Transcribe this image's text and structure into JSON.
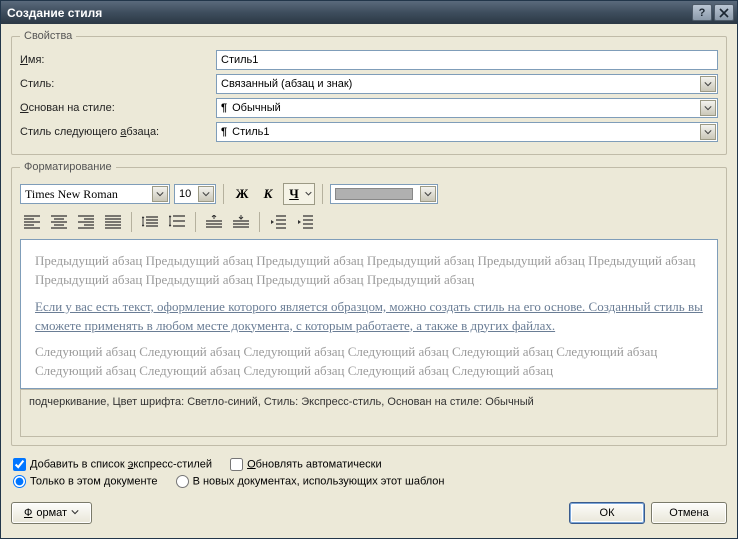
{
  "window": {
    "title": "Создание стиля",
    "help_aria": "Справка",
    "close_aria": "Закрыть"
  },
  "properties": {
    "legend": "Свойства",
    "name_label_pre": "",
    "name_label_ul": "И",
    "name_label_post": "мя:",
    "name_value": "Стиль1",
    "type_label": "Стиль:",
    "type_value": "Связанный (абзац и знак)",
    "based_label_pre": "",
    "based_label_ul": "О",
    "based_label_post": "снован на стиле:",
    "based_value": "Обычный",
    "next_label": "Стиль следующего ",
    "next_label_ul": "а",
    "next_label_post": "бзаца:",
    "next_value": "Стиль1"
  },
  "formatting": {
    "legend": "Форматирование",
    "font": "Times New Roman",
    "size": "10",
    "bold": "Ж",
    "italic": "К",
    "underline": "Ч"
  },
  "preview": {
    "prev_para": "Предыдущий абзац Предыдущий абзац Предыдущий абзац Предыдущий абзац Предыдущий абзац Предыдущий абзац Предыдущий абзац Предыдущий абзац Предыдущий абзац Предыдущий абзац",
    "sample": "Если у вас есть текст, оформление которого является образцом, можно создать стиль на его основе. Созданный стиль вы сможете применять в любом месте документа, с которым работаете, а также в других файлах.",
    "next_para": "Следующий абзац Следующий абзац Следующий абзац Следующий абзац Следующий абзац Следующий абзац Следующий абзац Следующий абзац Следующий абзац Следующий абзац Следующий абзац"
  },
  "description": "подчеркивание, Цвет шрифта: Светло-синий, Стиль: Экспресс-стиль, Основан на стиле: Обычный",
  "options": {
    "quick_pre": "Добавить в список ",
    "quick_ul": "э",
    "quick_post": "кспресс-стилей",
    "auto_ul": "О",
    "auto_post": "бновлять автоматически",
    "only_doc": "Только в этом документе",
    "new_docs": "В новых документах, использующих этот шаблон"
  },
  "footer": {
    "format_pre": "Ф",
    "format_post": "ормат",
    "ok": "ОК",
    "cancel": "Отмена"
  }
}
